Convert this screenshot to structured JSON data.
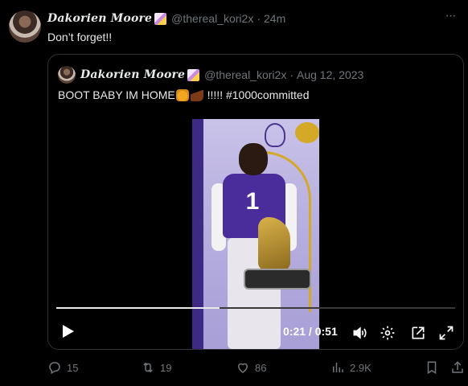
{
  "tweet": {
    "display_name": "Dakorien Moore",
    "handle": "@thereal_kori2x",
    "separator": "·",
    "time": "24m",
    "text": "Don’t forget!!"
  },
  "quote": {
    "display_name": "Dakorien Moore",
    "handle": "@thereal_kori2x",
    "separator": "·",
    "date": "Aug 12, 2023",
    "text_start": "BOOT BABY IM HOME",
    "text_end": " !!!!! #1000committed",
    "video": {
      "time_current": "0:21",
      "time_sep": " / ",
      "time_total": "0:51",
      "progress_fraction": 0.41,
      "jersey_number": "1"
    }
  },
  "actions": {
    "replies": "15",
    "reposts": "19",
    "likes": "86",
    "views": "2.9K"
  },
  "colors": {
    "background": "#000000",
    "text": "#e7e9ea",
    "muted": "#71767b",
    "border": "#2f3336"
  }
}
